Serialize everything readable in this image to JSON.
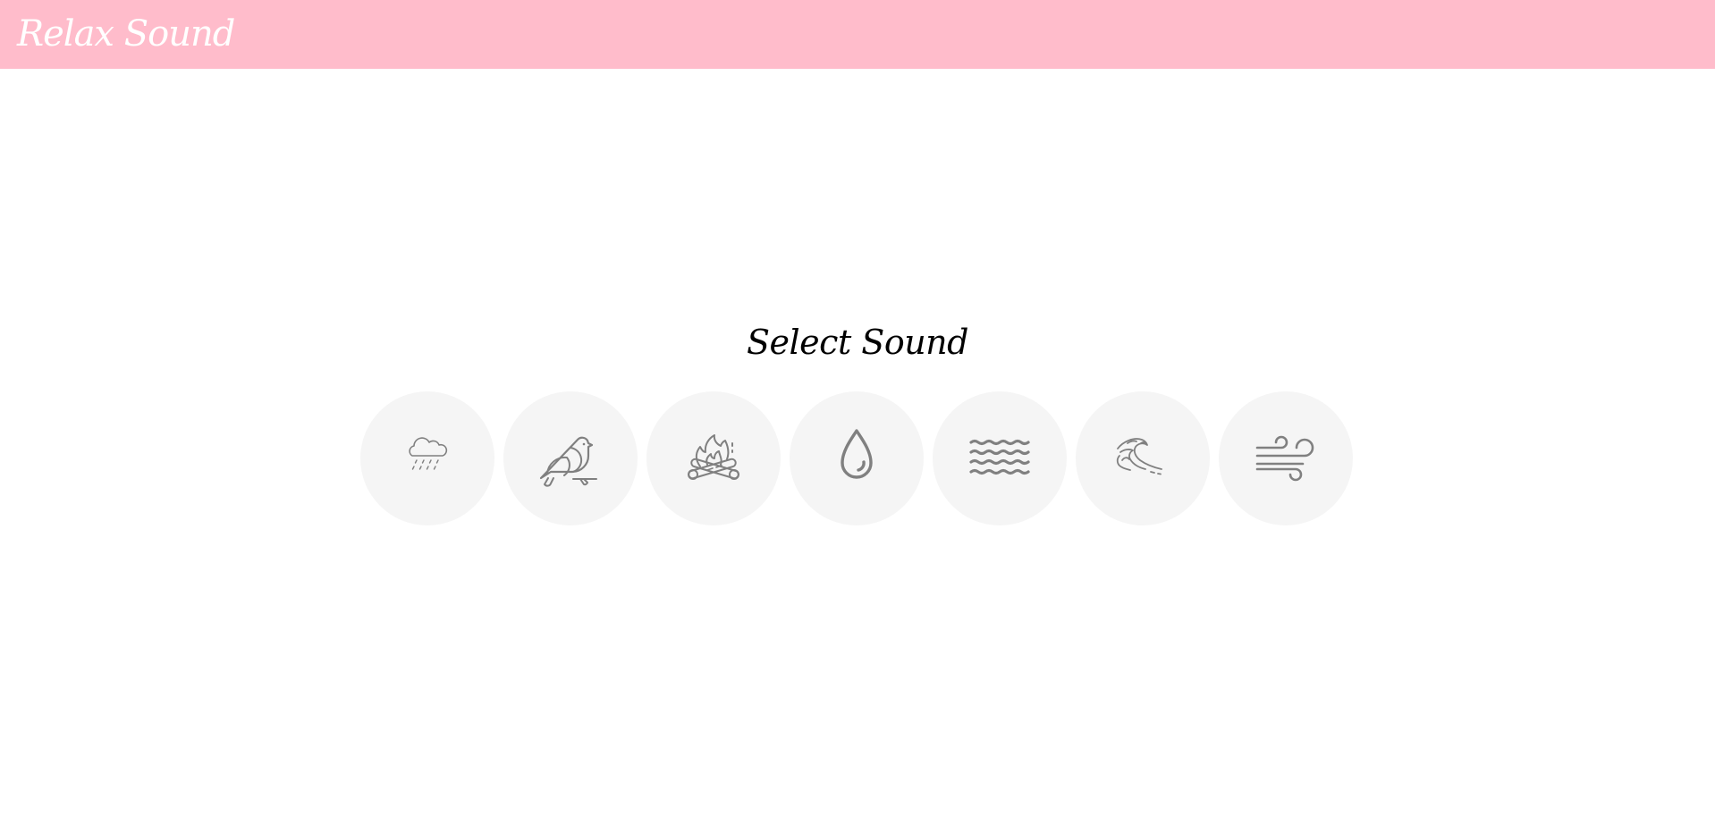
{
  "header": {
    "brand": "Relax Sound",
    "background_color": "#ffbccb",
    "brand_color": "#ffffff"
  },
  "main": {
    "heading": "Select Sound",
    "sound_buttons": [
      {
        "icon": "rain-cloud-icon"
      },
      {
        "icon": "bird-icon"
      },
      {
        "icon": "campfire-icon"
      },
      {
        "icon": "water-drop-icon"
      },
      {
        "icon": "waves-icon"
      },
      {
        "icon": "ocean-wave-icon"
      },
      {
        "icon": "wind-icon"
      }
    ],
    "button_color": "#f5f5f5",
    "icon_color": "#808080"
  }
}
